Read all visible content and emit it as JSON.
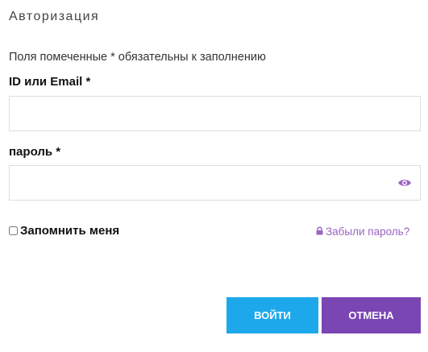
{
  "dialog": {
    "title": "Авторизация",
    "required_note": "Поля помеченные * обязательны к заполнению"
  },
  "login_field": {
    "label": "ID или Email *",
    "value": "",
    "placeholder": ""
  },
  "password_field": {
    "label": "пароль *",
    "value": "",
    "placeholder": "",
    "toggle_icon": "eye-icon"
  },
  "remember": {
    "label": "Запомнить меня",
    "checked": false
  },
  "forgot": {
    "label": "Забыли пароль?",
    "icon": "lock-icon"
  },
  "buttons": {
    "login_label": "ВОЙТИ",
    "cancel_label": "ОТМЕНА"
  },
  "colors": {
    "login_button": "#1ea8ec",
    "cancel_button": "#7a46b4",
    "link": "#9b63c2"
  }
}
